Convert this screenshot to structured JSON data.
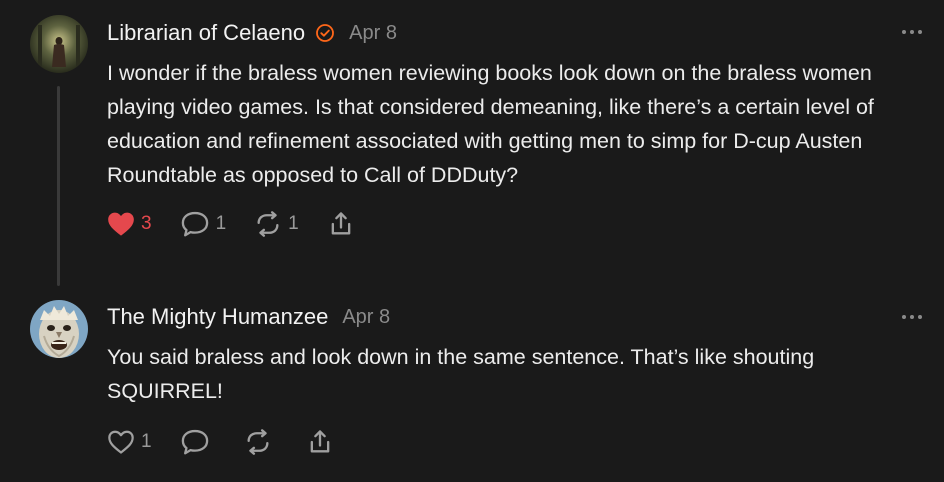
{
  "comments": [
    {
      "author": "Librarian of Celaeno",
      "verified": true,
      "date": "Apr 8",
      "text": "I wonder if the braless women reviewing books look down on the braless women playing video games. Is that considered demeaning, like there’s a certain level of education and refinement associated with getting men to simp for D-cup Austen Roundtable as opposed to Call of DDDuty?",
      "likes": "3",
      "liked": true,
      "replies": "1",
      "restacks": "1",
      "icons": [
        "heart-filled-icon",
        "comment-icon",
        "restack-icon",
        "share-icon"
      ],
      "accent_color": "#e5484d"
    },
    {
      "author": "The Mighty Humanzee",
      "verified": false,
      "date": "Apr 8",
      "text": "You said braless and look down in the same sentence. That’s like shouting SQUIRREL!",
      "likes": "1",
      "liked": false,
      "replies": "",
      "restacks": "",
      "icons": [
        "heart-icon",
        "comment-icon",
        "restack-icon",
        "share-icon"
      ]
    }
  ]
}
